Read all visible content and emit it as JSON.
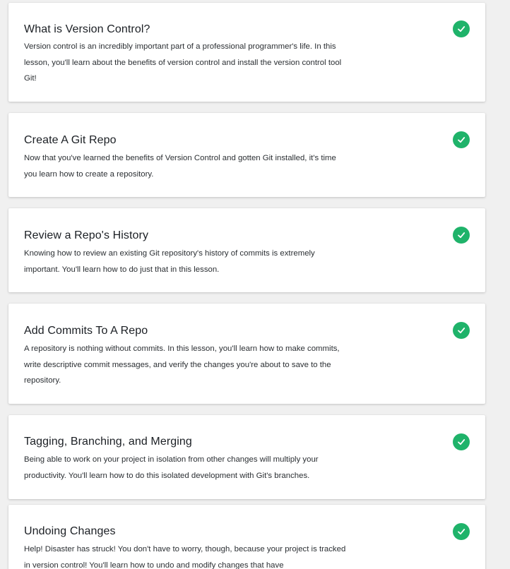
{
  "lessons": [
    {
      "title": "What is Version Control?",
      "description": "Version control is an incredibly important part of a professional programmer's life. In this lesson, you'll learn about the benefits of version control and install the version control tool Git!",
      "completed": true
    },
    {
      "title": "Create A Git Repo",
      "description": "Now that you've learned the benefits of Version Control and gotten Git installed, it's time you learn how to create a repository.",
      "completed": true
    },
    {
      "title": "Review a Repo's History",
      "description": "Knowing how to review an existing Git repository's history of commits is extremely important. You'll learn how to do just that in this lesson.",
      "completed": true
    },
    {
      "title": "Add Commits To A Repo",
      "description": "A repository is nothing without commits. In this lesson, you'll learn how to make commits, write descriptive commit messages, and verify the changes you're about to save to the repository.",
      "completed": true
    },
    {
      "title": "Tagging, Branching, and Merging",
      "description": "Being able to work on your project in isolation from other changes will multiply your productivity. You'll learn how to do this isolated development with Git's branches.",
      "completed": true
    },
    {
      "title": "Undoing Changes",
      "description": "Help! Disaster has struck! You don't have to worry, though, because your project is tracked in version control! You'll learn how to undo and modify changes that have",
      "completed": true
    }
  ],
  "colors": {
    "check_badge": "#1fb36a",
    "card_background": "#ffffff",
    "page_background": "#f0f0f0"
  },
  "icons": {
    "completed": "checkmark-circle-icon"
  }
}
